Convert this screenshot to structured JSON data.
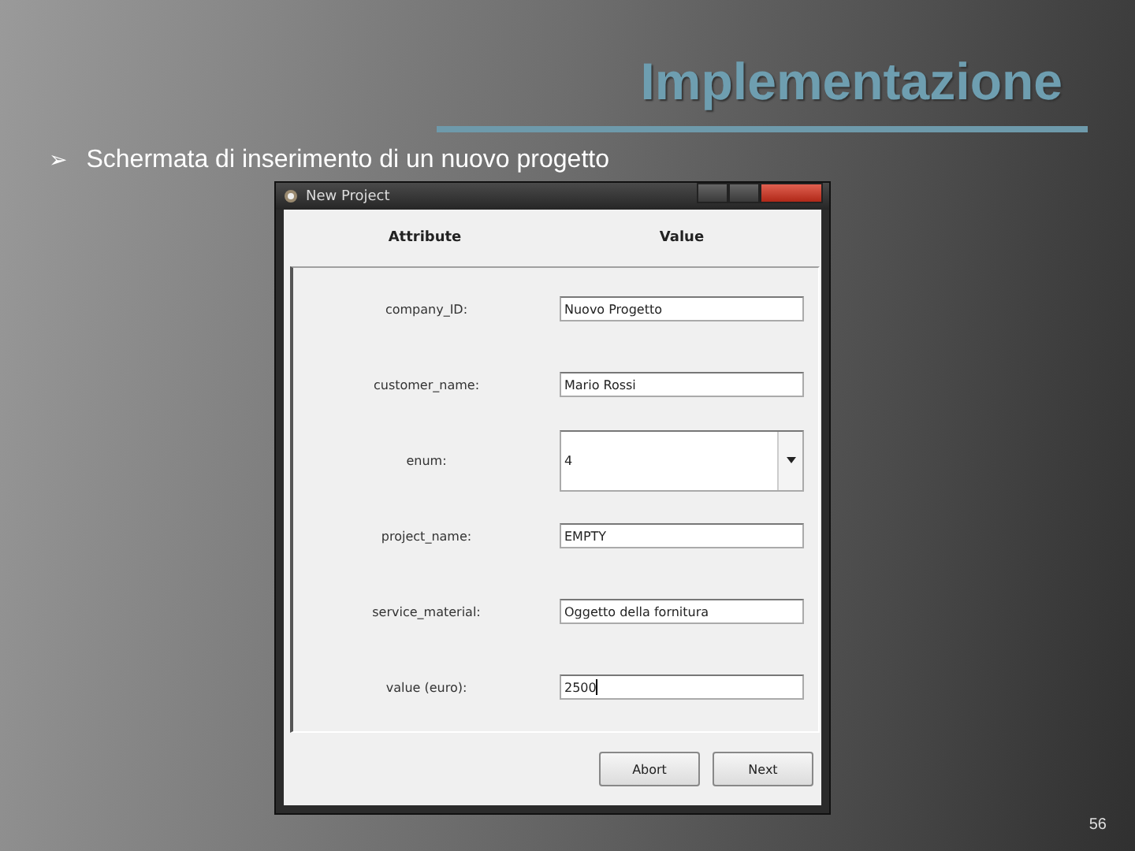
{
  "slide": {
    "title": "Implementazione",
    "bullet": {
      "marker": "➢",
      "text": "Schermata di inserimento di un nuovo progetto"
    },
    "page_number": "56"
  },
  "window": {
    "title": "New Project",
    "columns": [
      "Attribute",
      "Value"
    ],
    "fields": [
      {
        "label": "company_ID:",
        "kind": "text",
        "value": "Nuovo Progetto",
        "focused": false
      },
      {
        "label": "customer_name:",
        "kind": "text",
        "value": "Mario Rossi",
        "focused": false
      },
      {
        "label": "enum:",
        "kind": "combo",
        "value": "4",
        "focused": false
      },
      {
        "label": "project_name:",
        "kind": "text",
        "value": "EMPTY",
        "focused": false
      },
      {
        "label": "service_material:",
        "kind": "text",
        "value": "Oggetto della fornitura",
        "focused": false
      },
      {
        "label": "value (euro):",
        "kind": "text",
        "value": "2500",
        "focused": true
      }
    ],
    "buttons": [
      "Abort",
      "Next"
    ]
  }
}
